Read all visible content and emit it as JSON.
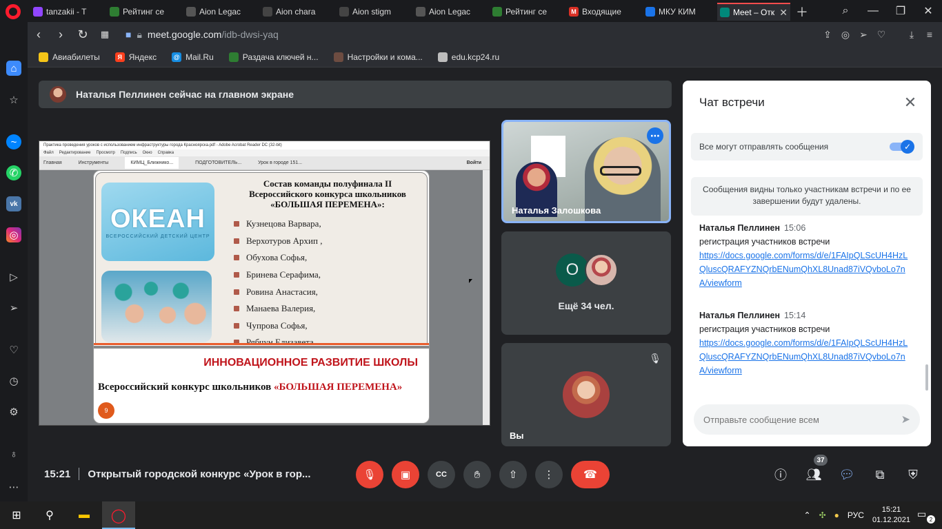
{
  "browser": {
    "tabs": [
      {
        "label": "tanzakii - T",
        "color": "#9146ff",
        "icon": "twitch-icon"
      },
      {
        "label": "Рейтинг се",
        "color": "#2e7d32",
        "icon": "tracker-icon"
      },
      {
        "label": "Aion Legac",
        "color": "#555555",
        "icon": "aion-icon"
      },
      {
        "label": "Aion chara",
        "color": "#444444",
        "icon": "globe-icon"
      },
      {
        "label": "Aion stigm",
        "color": "#444444",
        "icon": "globe-icon"
      },
      {
        "label": "Aion Legac",
        "color": "#555555",
        "icon": "aion-icon"
      },
      {
        "label": "Рейтинг се",
        "color": "#2e7d32",
        "icon": "tracker-icon"
      },
      {
        "label": "Входящие",
        "color": "#d93025",
        "icon": "gmail-icon"
      },
      {
        "label": "МКУ КИМ",
        "color": "#1a73e8",
        "icon": "site-icon"
      },
      {
        "label": "Meet – Отк",
        "color": "#00897b",
        "icon": "meet-icon"
      }
    ],
    "url_host": "meet.google.com",
    "url_path": "/idb-dwsi-yaq",
    "bookmarks": [
      {
        "label": "Авиабилеты",
        "color": "#f5c518"
      },
      {
        "label": "Яндекс",
        "color": "#fc3f1d",
        "glyph": "Я"
      },
      {
        "label": "Mail.Ru",
        "color": "#168de2",
        "glyph": "@"
      },
      {
        "label": "Раздача ключей н...",
        "color": "#2e7d32"
      },
      {
        "label": "Настройки и кома...",
        "color": "#6d4c41"
      },
      {
        "label": "edu.kcp24.ru",
        "color": "#bdbdbd"
      }
    ]
  },
  "meet": {
    "banner": "Наталья Пеллинен сейчас на главном экране",
    "shared": {
      "window_title": "Практика проведения уроков с использованием инфраструктуры города Красноярска.pdf - Adobe Acrobat Reader DC (32-bit)",
      "menu": [
        "Файл",
        "Редактирование",
        "Просмотр",
        "Подпись",
        "Окно",
        "Справка"
      ],
      "tabs": [
        "Главная",
        "Инструменты",
        "КИМЦ_Ближнико...",
        "ПОДГОТОВИТЕЛЬ...",
        "Урок в городе 151..."
      ],
      "login": "Войти",
      "logo_big": "ОКЕАН",
      "logo_small": "ВСЕРОССИЙСКИЙ ДЕТСКИЙ ЦЕНТР",
      "heading1": "Состав команды полуфинала II",
      "heading2": "Всероссийского конкурса школьников",
      "heading3": "«БОЛЬШАЯ ПЕРЕМЕНА»:",
      "names": [
        "Кузнецова Варвара,",
        "Верхотуров Архип ,",
        "Обухова Софья,",
        "Бринева Серафима,",
        "Ровина Анастасия,",
        "Манаева Валерия,",
        "Чупрова Софья,",
        "Рябчун Елизавета."
      ],
      "innovation": "ИННОВАЦИОННОЕ РАЗВИТИЕ ШКОЛЫ",
      "contest_black": "Всероссийский конкурс школьников ",
      "contest_red": "«БОЛЬШАЯ ПЕРЕМЕНА»",
      "page": "9"
    },
    "tiles": {
      "speaker_name": "Наталья Залошкова",
      "more_initial": "О",
      "more_text": "Ещё 34 чел.",
      "self_name": "Вы"
    },
    "chat": {
      "title": "Чат встречи",
      "permission": "Все могут отправлять сообщения",
      "notice": "Сообщения видны только участникам встречи и по ее завершении будут удалены.",
      "messages": [
        {
          "author": "Наталья Пеллинен",
          "time": "15:06",
          "text": "регистрация участников встречи",
          "link": "https://docs.google.com/forms/d/e/1FAIpQLScUH4HzLQluscQRAFYZNQrbENumQhXL8Unad87iVQvboLo7nA/viewform"
        },
        {
          "author": "Наталья Пеллинен",
          "time": "15:14",
          "text": "регистрация участников встречи",
          "link": "https://docs.google.com/forms/d/e/1FAIpQLScUH4HzLQluscQRAFYZNQrbENumQhXL8Unad87iVQvboLo7nA/viewform"
        }
      ],
      "placeholder": "Отправьте сообщение всем"
    },
    "footer": {
      "time": "15:21",
      "meeting_title": "Открытый городской конкурс «Урок в гор...",
      "participants": "37"
    }
  },
  "taskbar": {
    "lang": "РУС",
    "time": "15:21",
    "date": "01.12.2021",
    "notifications": "2"
  }
}
